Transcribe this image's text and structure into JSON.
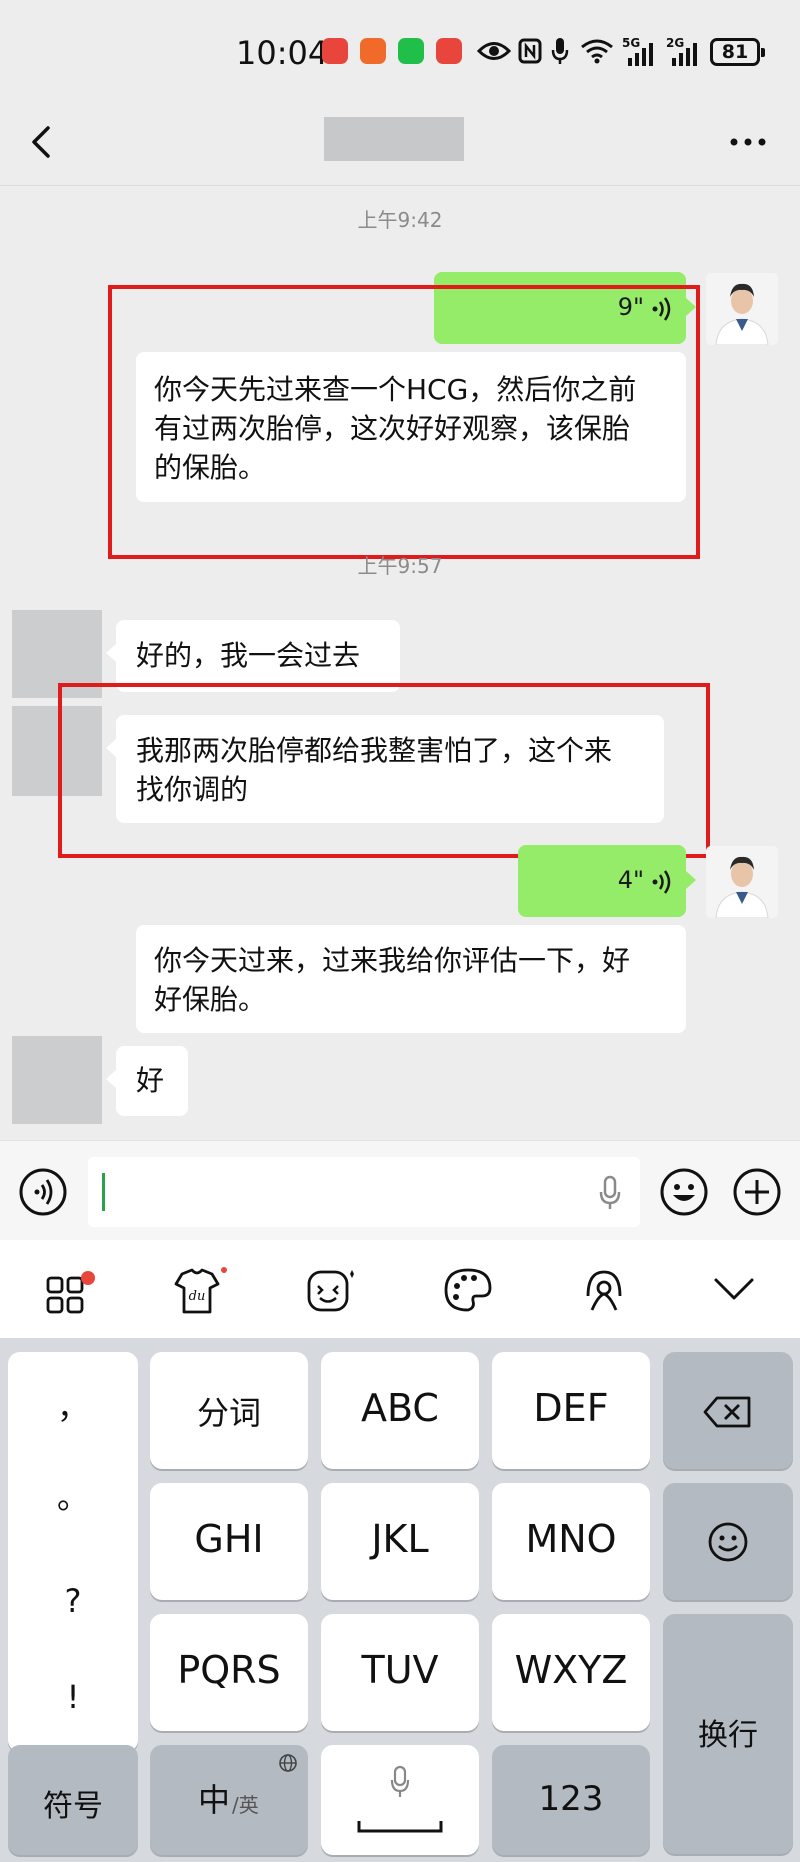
{
  "status_bar": {
    "time": "10:04",
    "battery": "81",
    "net1": "5G",
    "net2": "2G"
  },
  "chat": {
    "messages": [
      {
        "type": "time",
        "text": "上午9:42"
      },
      {
        "type": "voice",
        "side": "right",
        "duration": "9\""
      },
      {
        "type": "text",
        "side": "right",
        "lines": [
          "你今天先过来查一个HCG，然后你之前",
          "有过两次胎停，这次好好观察，该保胎",
          "的保胎。"
        ]
      },
      {
        "type": "time",
        "text": "上午9:57"
      },
      {
        "type": "text",
        "side": "left",
        "lines": [
          "好的，我一会过去"
        ]
      },
      {
        "type": "text",
        "side": "left",
        "lines": [
          "我那两次胎停都给我整害怕了，这个来",
          "找你调的"
        ]
      },
      {
        "type": "voice",
        "side": "right",
        "duration": "4\""
      },
      {
        "type": "text",
        "side": "right",
        "lines": [
          "你今天过来，过来我给你评估一下，好",
          "好保胎。"
        ]
      },
      {
        "type": "text",
        "side": "left",
        "lines": [
          "好"
        ]
      }
    ]
  },
  "keyboard": {
    "punct": [
      "，",
      "。",
      "?",
      "!"
    ],
    "row1": [
      "分词",
      "ABC",
      "DEF"
    ],
    "row2": [
      "GHI",
      "JKL",
      "MNO"
    ],
    "row3": [
      "PQRS",
      "TUV",
      "WXYZ"
    ],
    "symbols": "符号",
    "lang_main": "中",
    "lang_alt": "/英",
    "numbers": "123",
    "enter": "换行"
  },
  "colors": {
    "accent_green": "#95ec69",
    "highlight_red": "#e01b1b",
    "caret_green": "#2ba245"
  }
}
